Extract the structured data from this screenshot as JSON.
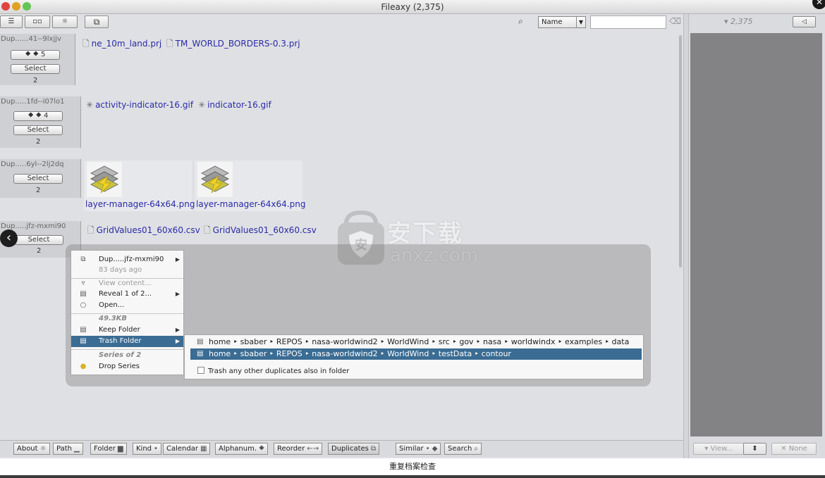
{
  "window": {
    "title": "Fileaxy  (2,375)",
    "caption": "重复档案检查"
  },
  "toolbar": {
    "menu_icon": "☰",
    "view_icon": "▫▫",
    "settings_icon": "☼",
    "duplicates_icon": "⧉",
    "sort_value": "Name",
    "search_placeholder": ""
  },
  "series": [
    {
      "name": "Dup......41--9lxjjv",
      "count_label": "⯁ ⯁ 5",
      "select_label": "Select",
      "count": "2",
      "files": [
        "ne_10m_land.prj",
        "TM_WORLD_BORDERS-0.3.prj"
      ]
    },
    {
      "name": "Dup.....1fd--i07lo1",
      "count_label": "⯁ ⯁ 4",
      "select_label": "Select",
      "count": "2",
      "files": [
        "activity-indicator-16.gif",
        "indicator-16.gif"
      ]
    },
    {
      "name": "Dup.....6yl--2lj2dq",
      "select_label": "Select",
      "count": "2",
      "files": [
        "layer-manager-64x64.png",
        "layer-manager-64x64.png"
      ]
    },
    {
      "name": "Dup.....jfz-mxmi90",
      "select_label": "Select",
      "count": "2",
      "files": [
        "GridValues01_60x60.csv",
        "GridValues01_60x60.csv"
      ]
    }
  ],
  "context_menu": {
    "series_name": "Dup.....jfz-mxmi90",
    "age": "83 days ago",
    "view_content": "View content...",
    "reveal": "Reveal 1 of 2...",
    "open": "Open...",
    "size": "49.3KB",
    "keep_folder": "Keep Folder",
    "trash_folder": "Trash Folder",
    "series_of": "Series of 2",
    "drop_series": "Drop Series"
  },
  "trash_submenu": {
    "paths": [
      "home ‣ sbaber ‣ REPOS ‣ nasa-worldwind2 ‣ WorldWind ‣ src ‣ gov ‣ nasa ‣ worldwindx ‣ examples ‣ data",
      "home ‣ sbaber ‣ REPOS ‣ nasa-worldwind2 ‣ WorldWind ‣ testData ‣ contour"
    ],
    "trash_other": "Trash any other duplicates also in folder"
  },
  "watermark": {
    "cn": "安下载",
    "en": "anxz.com"
  },
  "bottom_tabs": [
    {
      "label": "About",
      "icon": "☼"
    },
    {
      "label": "Path",
      "icon": "▁"
    },
    {
      "label": "Folder",
      "icon": "▆"
    },
    {
      "label": "Kind",
      "icon": "•"
    },
    {
      "label": "Calendar",
      "icon": "▦"
    },
    {
      "label": "Alphanum.",
      "icon": "⯁"
    },
    {
      "label": "Reorder",
      "icon": "←→"
    },
    {
      "label": "Duplicates",
      "icon": "⧉"
    },
    {
      "label": "Similar",
      "icon": "• ◆"
    },
    {
      "label": "Search",
      "icon": "⌕"
    }
  ],
  "right_panel": {
    "count": "▾ 2,375",
    "back_icon": "◁",
    "view_label": "▾ View...",
    "stepper_label": "⬍",
    "none_label": "✕ None"
  },
  "colors": {
    "selection": "#3b6c93",
    "link_text": "#2a2aa8",
    "preview_bg": "#838386"
  }
}
